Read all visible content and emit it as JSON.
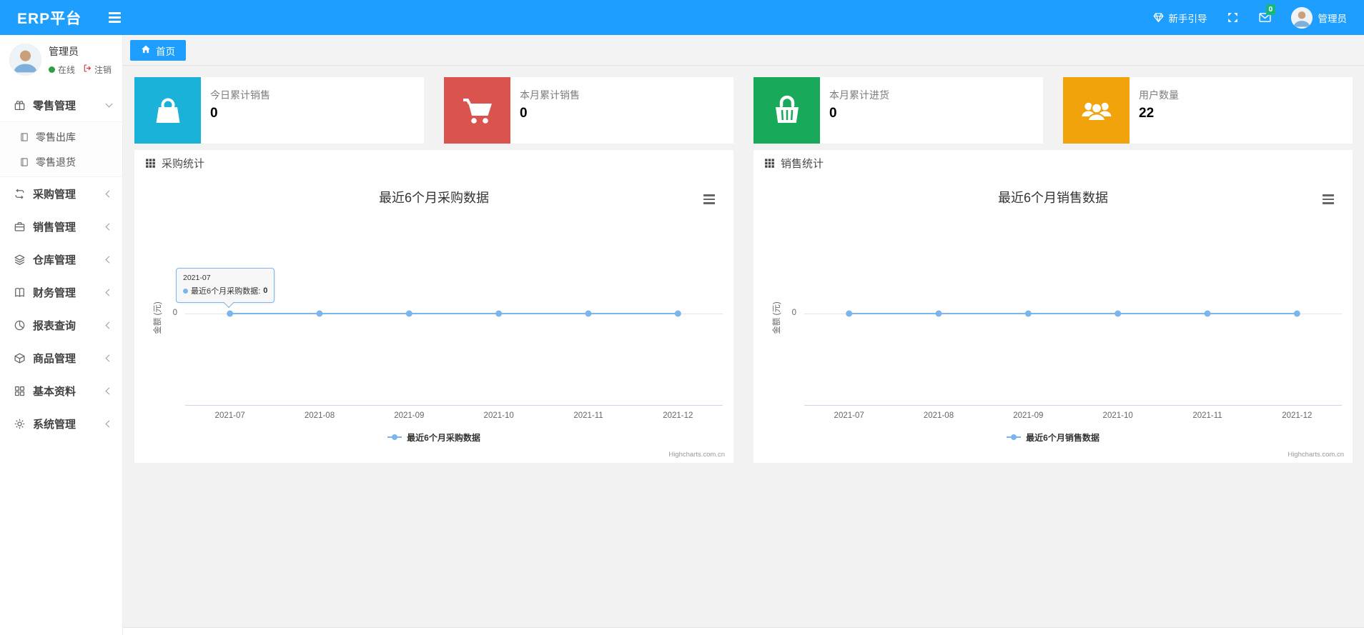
{
  "navbar": {
    "brand": "ERP平台",
    "guide_label": "新手引导",
    "mail_badge": "0",
    "user_name": "管理员",
    "bg_color": "#1e9fff",
    "badge_color": "#16b777"
  },
  "sidebar": {
    "user": {
      "name": "管理员",
      "status": "在线",
      "logout_label": "注销",
      "online_color": "#2f9e44"
    },
    "menu": [
      {
        "key": "retail",
        "label": "零售管理",
        "icon": "gift-icon",
        "expanded": true,
        "children": [
          {
            "key": "retail-out",
            "label": "零售出库",
            "icon": "file-icon"
          },
          {
            "key": "retail-return",
            "label": "零售退货",
            "icon": "file-icon"
          }
        ]
      },
      {
        "key": "purchase",
        "label": "采购管理",
        "icon": "repeat-icon",
        "expanded": false
      },
      {
        "key": "sales",
        "label": "销售管理",
        "icon": "briefcase-icon",
        "expanded": false
      },
      {
        "key": "warehouse",
        "label": "仓库管理",
        "icon": "layers-icon",
        "expanded": false
      },
      {
        "key": "finance",
        "label": "财务管理",
        "icon": "book-icon",
        "expanded": false
      },
      {
        "key": "report",
        "label": "报表查询",
        "icon": "clock-icon",
        "expanded": false
      },
      {
        "key": "goods",
        "label": "商品管理",
        "icon": "box-icon",
        "expanded": false
      },
      {
        "key": "basic",
        "label": "基本资料",
        "icon": "grid-icon",
        "expanded": false
      },
      {
        "key": "system",
        "label": "系统管理",
        "icon": "gear-icon",
        "expanded": false
      }
    ]
  },
  "tabs": [
    {
      "label": "首页",
      "icon": "home-icon",
      "active": true
    }
  ],
  "stat_cards": [
    {
      "key": "today-sales",
      "label": "今日累计销售",
      "value": "0",
      "color": "#1ab2d8",
      "icon": "shopping-bag-icon"
    },
    {
      "key": "month-sales",
      "label": "本月累计销售",
      "value": "0",
      "color": "#d9534f",
      "icon": "cart-icon"
    },
    {
      "key": "month-purchase",
      "label": "本月累计进货",
      "value": "0",
      "color": "#18a95b",
      "icon": "basket-icon"
    },
    {
      "key": "user-count",
      "label": "用户数量",
      "value": "22",
      "color": "#f0a30a",
      "icon": "users-icon"
    }
  ],
  "chart_data": [
    {
      "key": "purchase-stats",
      "type": "line",
      "panel_title": "采购统计",
      "title": "最近6个月采购数据",
      "categories": [
        "2021-07",
        "2021-08",
        "2021-09",
        "2021-10",
        "2021-11",
        "2021-12"
      ],
      "series": [
        {
          "name": "最近6个月采购数据",
          "values": [
            0,
            0,
            0,
            0,
            0,
            0
          ],
          "color": "#7cb5ec"
        }
      ],
      "ylabel": "金额 (元)",
      "yticks": [
        0
      ],
      "grid": true,
      "legend_position": "bottom",
      "credit": "Highcharts.com.cn",
      "tooltip": {
        "visible": true,
        "category": "2021-07",
        "series_name": "最近6个月采购数据",
        "value": "0"
      }
    },
    {
      "key": "sales-stats",
      "type": "line",
      "panel_title": "销售统计",
      "title": "最近6个月销售数据",
      "categories": [
        "2021-07",
        "2021-08",
        "2021-09",
        "2021-10",
        "2021-11",
        "2021-12"
      ],
      "series": [
        {
          "name": "最近6个月销售数据",
          "values": [
            0,
            0,
            0,
            0,
            0,
            0
          ],
          "color": "#7cb5ec"
        }
      ],
      "ylabel": "金额 (元)",
      "yticks": [
        0
      ],
      "grid": true,
      "legend_position": "bottom",
      "credit": "Highcharts.com.cn",
      "tooltip": {
        "visible": false
      }
    }
  ]
}
